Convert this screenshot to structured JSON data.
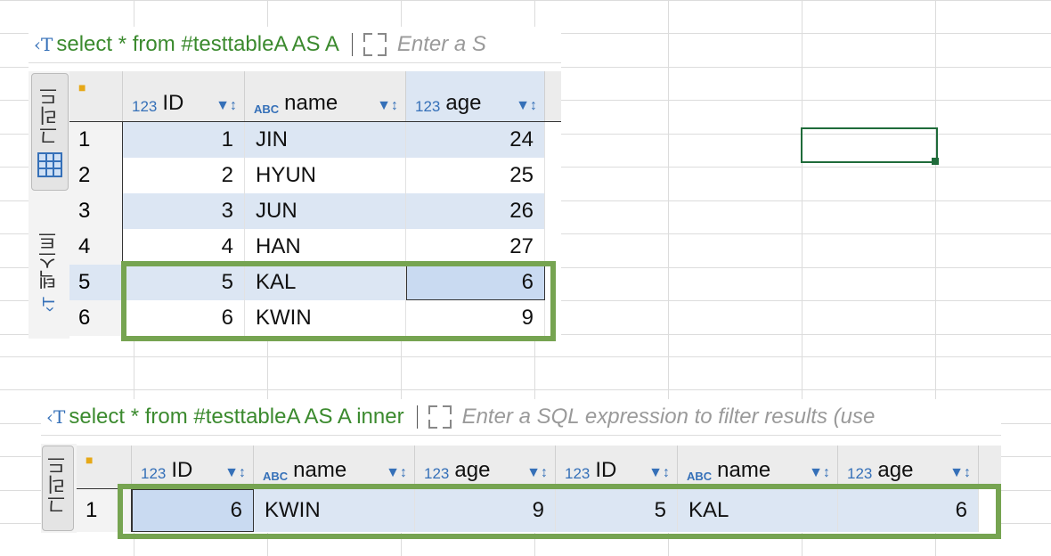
{
  "panel1": {
    "sql": "select * from #testtableA AS A",
    "placeholder": "Enter a S",
    "tabs": {
      "grid": "그리드",
      "text": "텍스트"
    },
    "columns": [
      {
        "type": "123",
        "name": "ID"
      },
      {
        "type": "ABC",
        "name": "name"
      },
      {
        "type": "123",
        "name": "age"
      }
    ],
    "rows": [
      {
        "num": "1",
        "id": "1",
        "name": "JIN",
        "age": "24"
      },
      {
        "num": "2",
        "id": "2",
        "name": "HYUN",
        "age": "25"
      },
      {
        "num": "3",
        "id": "3",
        "name": "JUN",
        "age": "26"
      },
      {
        "num": "4",
        "id": "4",
        "name": "HAN",
        "age": "27"
      },
      {
        "num": "5",
        "id": "5",
        "name": "KAL",
        "age": "6"
      },
      {
        "num": "6",
        "id": "6",
        "name": "KWIN",
        "age": "9"
      }
    ]
  },
  "panel2": {
    "sql": "select * from #testtableA AS A inner",
    "placeholder": "Enter a SQL expression to filter results (use",
    "tabs": {
      "grid": "그리드"
    },
    "columns": [
      {
        "type": "123",
        "name": "ID"
      },
      {
        "type": "ABC",
        "name": "name"
      },
      {
        "type": "123",
        "name": "age"
      },
      {
        "type": "123",
        "name": "ID"
      },
      {
        "type": "ABC",
        "name": "name"
      },
      {
        "type": "123",
        "name": "age"
      }
    ],
    "rows": [
      {
        "num": "1",
        "c1": "6",
        "c2": "KWIN",
        "c3": "9",
        "c4": "5",
        "c5": "KAL",
        "c6": "6"
      }
    ]
  },
  "icons": {
    "lock": "lock-icon",
    "filter_sort": "filter-sort-icon",
    "sql": "sql-text-icon",
    "expand": "expand-icon"
  },
  "colors": {
    "highlight": "#76a451",
    "selected_row": "#dce6f3",
    "accent": "#3570b8",
    "sql_green": "#3b8a2e"
  }
}
